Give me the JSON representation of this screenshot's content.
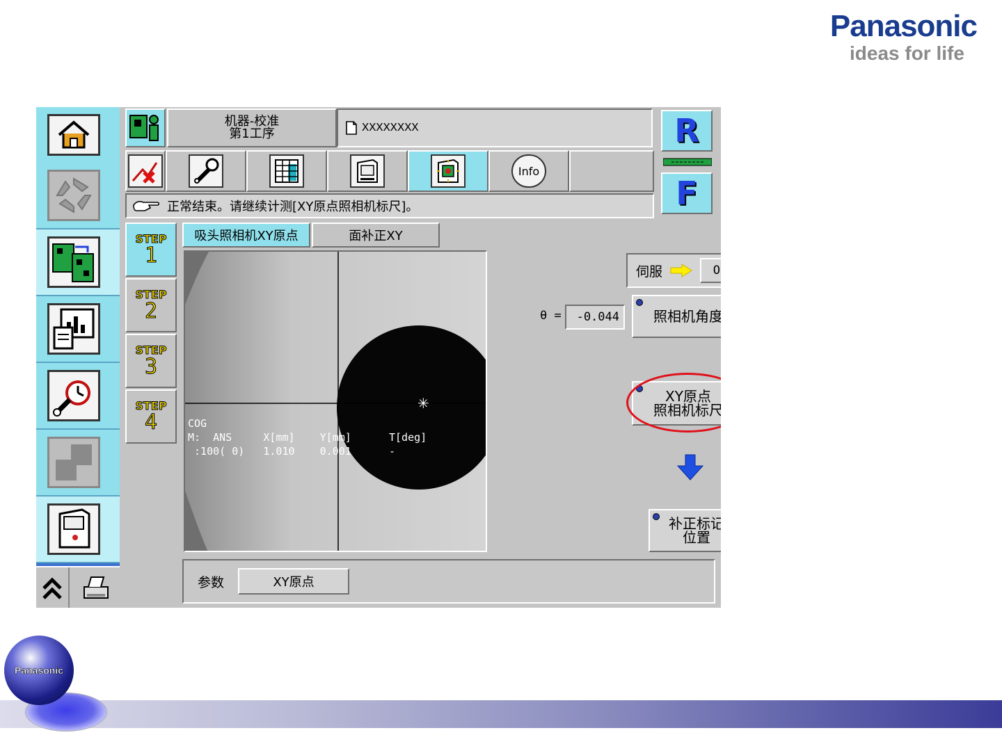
{
  "brand": {
    "name": "Panasonic",
    "tagline": "ideas for life",
    "globe_label": "Panasonic"
  },
  "header": {
    "title_line1": "机器-校准",
    "title_line2": "第1工序",
    "file_name": "XXXXXXXX"
  },
  "rf": {
    "r_label": "R",
    "f_label": "F"
  },
  "message": "正常结束。请继续计测[XY原点照相机标尺]。",
  "steps": [
    {
      "label": "STEP",
      "number": "1"
    },
    {
      "label": "STEP",
      "number": "2"
    },
    {
      "label": "STEP",
      "number": "3"
    },
    {
      "label": "STEP",
      "number": "4"
    }
  ],
  "tabs": [
    "吸头照相机XY原点",
    "面补正XY"
  ],
  "camera": {
    "cog": "COG",
    "header_row": "M:  ANS     X[mm]    Y[mm]      T[deg]",
    "value_row": " :100( 0)   1.010    0.001      -"
  },
  "controls": {
    "servo_label": "伺服",
    "servo_state": "ON",
    "theta_label": "θ =",
    "theta_value": "-0.044",
    "camera_angle": "照相机角度",
    "xy_line1": "XY原点",
    "xy_line2": "照相机标尺",
    "mark_line1": "补正标记",
    "mark_line2": "位置"
  },
  "params": {
    "label": "参数",
    "value": "XY原点"
  },
  "colors": {
    "accent_cyan": "#8fe0ec",
    "sidebar_blue": "#3b6fd0",
    "highlight_red": "#e0101a",
    "arrow_blue": "#1f4fe0"
  }
}
